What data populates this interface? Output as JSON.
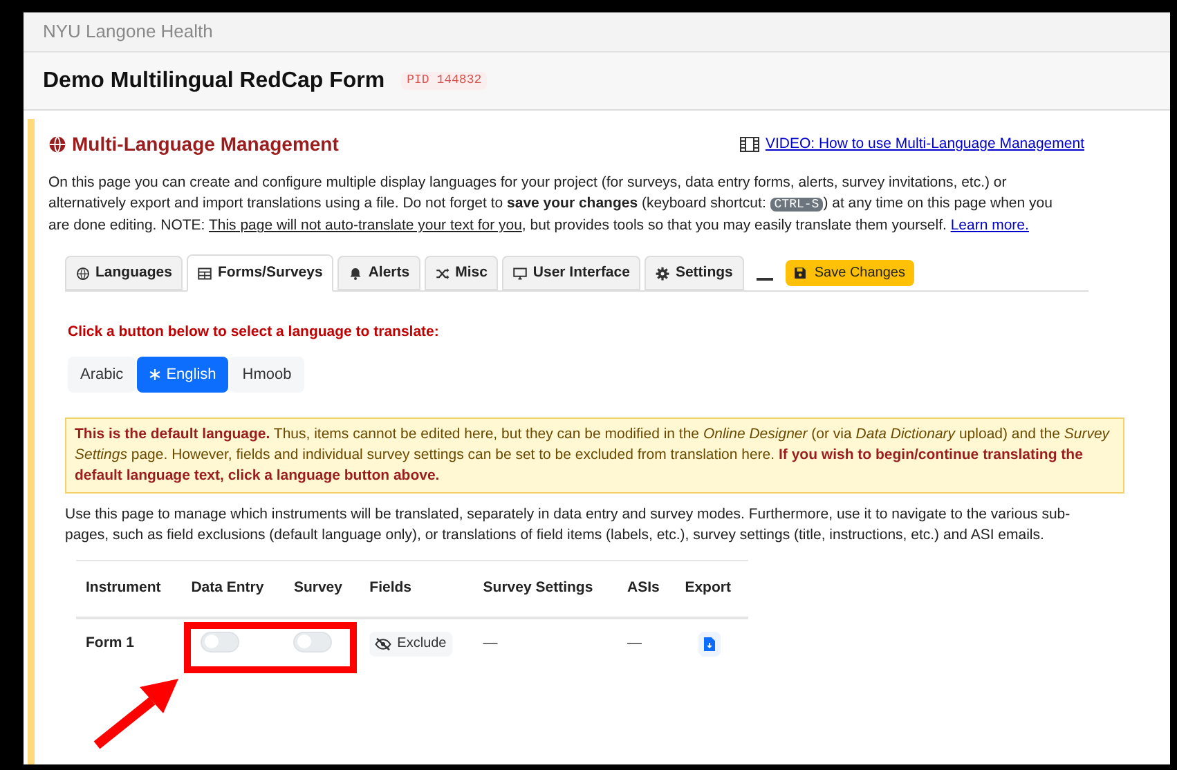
{
  "org": "NYU Langone Health",
  "project": {
    "title": "Demo Multilingual RedCap Form",
    "pid": "PID 144832"
  },
  "section": {
    "title": "Multi-Language Management",
    "video_link": "VIDEO: How to use Multi-Language Management",
    "intro": "On this page you can create and configure multiple display languages for your project (for surveys, data entry forms, alerts, survey invitations, etc.) or alternatively export and import translations using a file. Do not forget to **save your changes** (keyboard shortcut: ",
    "shortcut": "CTRL-S",
    "intro_end": ") at any time on this page when you are done editing. NOTE: ",
    "note": "This page will not auto-translate your text for you",
    "intro_tail": ", but provides tools so that you may easily translate them yourself. ",
    "learn_more": "Learn more."
  },
  "tabs": [
    {
      "label": "Languages",
      "selected": false
    },
    {
      "label": "Forms/Surveys",
      "selected": true
    },
    {
      "label": "Alerts",
      "selected": false
    },
    {
      "label": "Misc",
      "selected": false
    },
    {
      "label": "User Interface",
      "selected": false
    },
    {
      "label": "Settings",
      "selected": false
    }
  ],
  "save_button": "Save Changes",
  "prompt": "Click a button below to select a language to translate:",
  "languages": [
    {
      "label": "Arabic",
      "default": false,
      "selected": false
    },
    {
      "label": "English",
      "default": true,
      "selected": true
    },
    {
      "label": "Hmoob",
      "default": false,
      "selected": false
    }
  ],
  "notice": "**This is the default language.** Thus, items cannot be edited here, but they can be modified in the *Online Designer* (or via *Data Dictionary* upload) and the *Survey Settings* page. However, fields and individual survey settings can be set to be excluded from translation here. **If you wish to begin/continue translating the default language text, click a language button above.**",
  "description": "Use this page to manage which instruments will be translated, separately in data entry and survey modes. Furthermore, use it to navigate to the various sub-pages, such as field exclusions (default language only), or translations of field items (labels, etc.), survey settings (title, instructions, etc.) and ASI emails.",
  "table": {
    "columns": [
      "Instrument",
      "Data Entry",
      "Survey",
      "Fields",
      "Survey Settings",
      "ASIs",
      "Export"
    ],
    "rows": [
      {
        "instrument": "Form 1",
        "data_entry": {
          "on": false
        },
        "survey": {
          "on": false
        },
        "fields": "Exclude",
        "survey_settings": "—",
        "asis": "—"
      }
    ]
  }
}
